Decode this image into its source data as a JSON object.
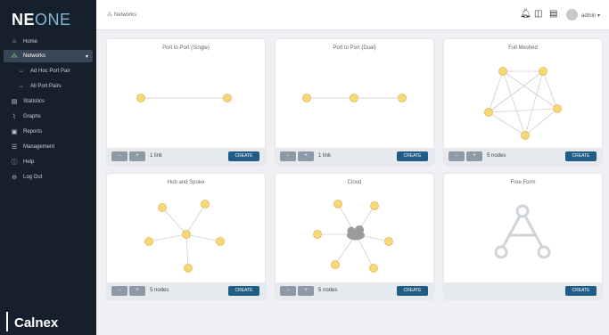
{
  "brand": {
    "logo_ne": "NE",
    "logo_one": "ONE",
    "footer_brand": "Calnex"
  },
  "sidebar": {
    "items": [
      {
        "label": "Home",
        "icon": "home-icon",
        "glyph": "⌂"
      },
      {
        "label": "Networks",
        "icon": "network-icon",
        "glyph": "⁂"
      },
      {
        "label": "Ad Hoc Port Pair",
        "icon": "port-pair-icon",
        "glyph": "↔"
      },
      {
        "label": "All Port Pairs",
        "icon": "port-pair-icon",
        "glyph": "↔"
      },
      {
        "label": "Statistics",
        "icon": "statistics-icon",
        "glyph": "▤"
      },
      {
        "label": "Graphs",
        "icon": "graph-icon",
        "glyph": "⌇"
      },
      {
        "label": "Reports",
        "icon": "report-icon",
        "glyph": "▣"
      },
      {
        "label": "Management",
        "icon": "management-icon",
        "glyph": "☰"
      },
      {
        "label": "Help",
        "icon": "help-icon",
        "glyph": "ⓘ"
      },
      {
        "label": "Log Out",
        "icon": "logout-icon",
        "glyph": "⊖"
      }
    ]
  },
  "topbar": {
    "breadcrumb": "Networks",
    "user": "admin"
  },
  "cards": [
    {
      "title": "Port to Port (Single)",
      "footer_text": "1 link",
      "action": "CREATE"
    },
    {
      "title": "Port to Port (Dual)",
      "footer_text": "1 link",
      "action": "CREATE"
    },
    {
      "title": "Full Meshed",
      "footer_text": "5 nodes",
      "action": "CREATE"
    },
    {
      "title": "Hub and Spoke",
      "footer_text": "5 nodes",
      "action": "CREATE"
    },
    {
      "title": "Cloud",
      "footer_text": "5 nodes",
      "action": "CREATE"
    },
    {
      "title": "Free Form",
      "footer_text": "",
      "action": "CREATE"
    }
  ],
  "colors": {
    "sidebar": "#16202d",
    "accent": "#1f5c86",
    "node": "#f6d77a",
    "node_stroke": "#e6b94a",
    "active_icon": "#6fd06a"
  }
}
